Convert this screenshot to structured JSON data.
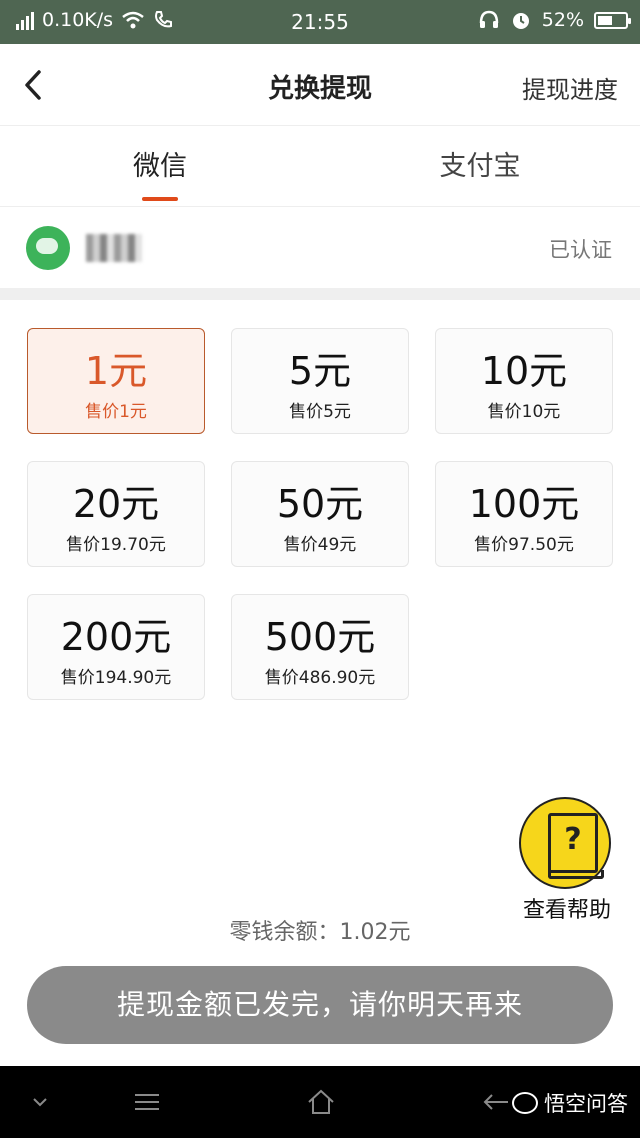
{
  "status_bar": {
    "network_speed": "0.10K/s",
    "time": "21:55",
    "battery": "52%",
    "battery_level": 0.52
  },
  "nav": {
    "title": "兑换提现",
    "right_link": "提现进度"
  },
  "tabs": [
    {
      "label": "微信",
      "active": true
    },
    {
      "label": "支付宝",
      "active": false
    }
  ],
  "account": {
    "status": "已认证"
  },
  "options": [
    {
      "amount": "1元",
      "price": "售价1元",
      "selected": true
    },
    {
      "amount": "5元",
      "price": "售价5元",
      "selected": false
    },
    {
      "amount": "10元",
      "price": "售价10元",
      "selected": false
    },
    {
      "amount": "20元",
      "price": "售价19.70元",
      "selected": false
    },
    {
      "amount": "50元",
      "price": "售价49元",
      "selected": false
    },
    {
      "amount": "100元",
      "price": "售价97.50元",
      "selected": false
    },
    {
      "amount": "200元",
      "price": "售价194.90元",
      "selected": false
    },
    {
      "amount": "500元",
      "price": "售价486.90元",
      "selected": false
    }
  ],
  "help": {
    "label": "查看帮助",
    "icon_glyph": "?"
  },
  "balance_text": "零钱余额：1.02元",
  "withdraw_button": "提现金额已发完，请你明天再来",
  "watermark": "悟空问答",
  "colors": {
    "status_bar": "#4f6652",
    "accent": "#e04a1a",
    "selected_card_border": "#b95a2c",
    "help_badge": "#f6d61b",
    "disabled_button": "#8a8a8a"
  }
}
